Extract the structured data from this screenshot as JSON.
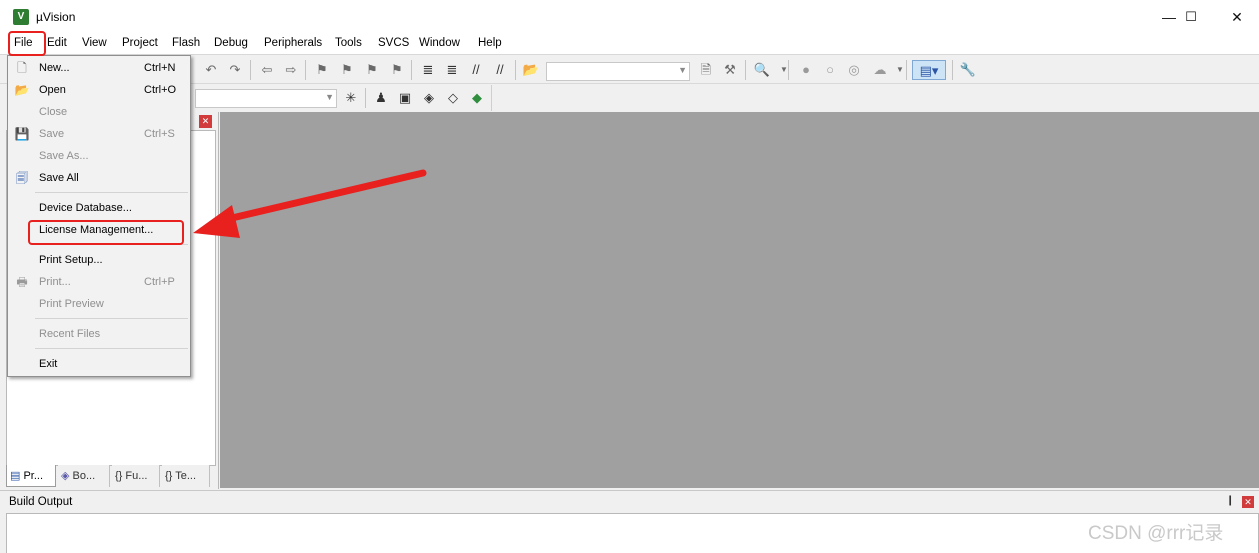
{
  "window": {
    "title": "µVision",
    "app_icon": "uv-icon",
    "minimize": "—",
    "maximize": "☐",
    "close": "✕"
  },
  "menubar": {
    "items": [
      "File",
      "Edit",
      "View",
      "Project",
      "Flash",
      "Debug",
      "Peripherals",
      "Tools",
      "SVCS",
      "Window",
      "Help"
    ]
  },
  "file_menu": {
    "items": [
      {
        "label": "New...",
        "shortcut": "Ctrl+N",
        "enabled": true,
        "icon": "new-file-icon"
      },
      {
        "label": "Open",
        "shortcut": "Ctrl+O",
        "enabled": true,
        "icon": "open-folder-icon"
      },
      {
        "label": "Close",
        "shortcut": "",
        "enabled": false
      },
      {
        "label": "Save",
        "shortcut": "Ctrl+S",
        "enabled": false,
        "icon": "save-icon"
      },
      {
        "label": "Save As...",
        "shortcut": "",
        "enabled": false
      },
      {
        "label": "Save All",
        "shortcut": "",
        "enabled": true,
        "icon": "save-all-icon"
      },
      {
        "label": "Device Database...",
        "shortcut": "",
        "enabled": true
      },
      {
        "label": "License Management...",
        "shortcut": "",
        "enabled": true
      },
      {
        "label": "Print Setup...",
        "shortcut": "",
        "enabled": true
      },
      {
        "label": "Print...",
        "shortcut": "Ctrl+P",
        "enabled": false,
        "icon": "print-icon"
      },
      {
        "label": "Print Preview",
        "shortcut": "",
        "enabled": false
      },
      {
        "label": "Recent Files",
        "shortcut": "",
        "enabled": false
      },
      {
        "label": "Exit",
        "shortcut": "",
        "enabled": true
      }
    ]
  },
  "left_panel": {
    "tabs": [
      "Pr...",
      "Bo...",
      "Fu...",
      "Te..."
    ],
    "active_tab": 0
  },
  "build_output": {
    "title": "Build Output",
    "pin": "❙"
  },
  "watermark": "CSDN @rrr记录",
  "colors": {
    "highlight": "#e8201e",
    "editor_bg": "#a0a0a0",
    "close_red": "#d23b3b"
  }
}
